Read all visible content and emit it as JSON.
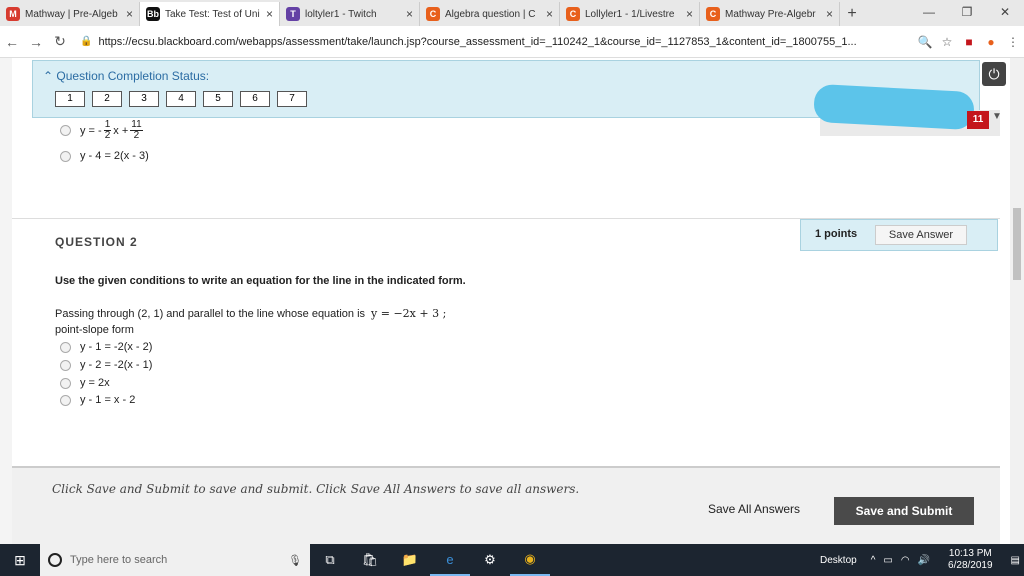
{
  "browser": {
    "tabs": [
      {
        "title": "Mathway | Pre-Algeb",
        "icon": "M",
        "color": "#d73b2f"
      },
      {
        "title": "Take Test: Test of Uni",
        "icon": "Bb",
        "color": "#111111",
        "active": true
      },
      {
        "title": "loltyler1 - Twitch",
        "icon": "T",
        "color": "#6441a5"
      },
      {
        "title": "Algebra question | C",
        "icon": "C",
        "color": "#e8601c"
      },
      {
        "title": "Lollyler1 - 1/Livestre",
        "icon": "C",
        "color": "#e8601c"
      },
      {
        "title": "Mathway Pre-Algebr",
        "icon": "C",
        "color": "#e8601c"
      }
    ],
    "url": "https://ecsu.blackboard.com/webapps/assessment/take/launch.jsp?course_assessment_id=_110242_1&course_id=_1127853_1&content_id=_1800755_1..."
  },
  "status": {
    "header": "Question Completion Status:",
    "numbers": [
      "1",
      "2",
      "3",
      "4",
      "5",
      "6",
      "7"
    ],
    "badge": "11"
  },
  "prev_options": {
    "opt1_prefix": "y = -",
    "opt1_frac1_num": "1",
    "opt1_frac1_den": "2",
    "opt1_mid": "x +",
    "opt1_frac2_num": "11",
    "opt1_frac2_den": "2",
    "opt2": "y - 4 = 2(x - 3)"
  },
  "question": {
    "title": "QUESTION 2",
    "points": "1 points",
    "save_label": "Save Answer",
    "instruction": "Use the given conditions to write an equation for the line in the indicated form.",
    "statement": "Passing through (2, 1) and parallel to the line whose equation is",
    "equation": "y = −2x + 3 ;",
    "form": "point-slope form",
    "options": [
      "y - 1 = -2(x - 2)",
      "y - 2 = -2(x - 1)",
      "y = 2x",
      "y - 1 = x - 2"
    ]
  },
  "footer": {
    "hint": "Click Save and Submit to save and submit. Click Save All Answers to save all answers.",
    "save_all": "Save All Answers",
    "submit": "Save and Submit"
  },
  "taskbar": {
    "search_placeholder": "Type here to search",
    "desktop": "Desktop",
    "time": "10:13 PM",
    "date": "6/28/2019"
  }
}
